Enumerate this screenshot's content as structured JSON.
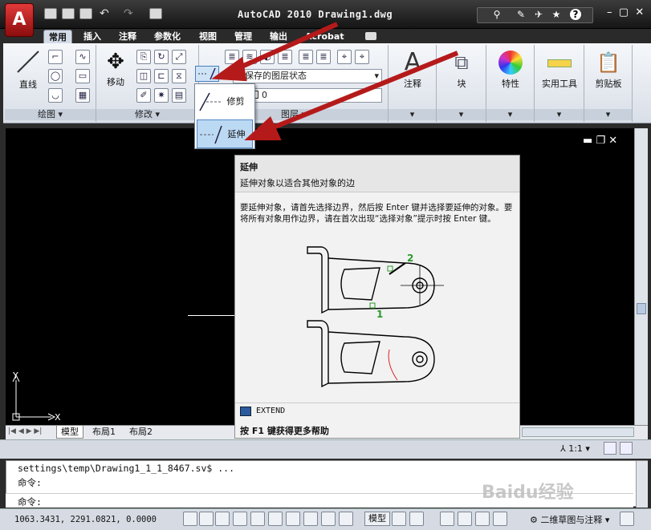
{
  "app": {
    "title": "AutoCAD 2010  Drawing1.dwg",
    "logo_letter": "A",
    "accent_color": "#c41e1e"
  },
  "quick_access": {
    "icons": [
      "new-icon",
      "open-icon",
      "save-icon",
      "undo-icon",
      "redo-icon",
      "plot-icon"
    ]
  },
  "ribbon": {
    "tabs": [
      "常用",
      "插入",
      "注释",
      "参数化",
      "视图",
      "管理",
      "输出",
      "Acrobat"
    ],
    "active_tab": "常用",
    "panels": {
      "draw": {
        "label": "绘图 ▾",
        "line_label": "直线"
      },
      "modify": {
        "label": "修改 ▾",
        "move_label": "移动"
      },
      "layers": {
        "label": "图层 ▾",
        "layer_state": "未保存的图层状态",
        "current_layer": "0"
      },
      "annotation": {
        "label": "注释"
      },
      "block": {
        "label": "块"
      },
      "properties": {
        "label": "特性"
      },
      "utilities": {
        "label": "实用工具"
      },
      "clipboard": {
        "label": "剪贴板"
      }
    }
  },
  "dropdown": {
    "items": [
      {
        "label": "修剪",
        "selected": false
      },
      {
        "label": "延伸",
        "selected": true
      }
    ]
  },
  "tooltip": {
    "title": "延伸",
    "subtitle": "延伸对象以适合其他对象的边",
    "body": "要延伸对象，请首先选择边界，然后按 Enter 键并选择要延伸的对象。要将所有对象用作边界，请在首次出现“选择对象”提示时按 Enter 键。",
    "marker_1": "1",
    "marker_2": "2",
    "command": "EXTEND",
    "help_hint": "按 F1 键获得更多帮助"
  },
  "canvas": {
    "ucs_x": "X",
    "ucs_y": "Y"
  },
  "layout_tabs": [
    "模型",
    "布局1",
    "布局2"
  ],
  "annotation_scale": "1:1",
  "command_line": {
    "history_1": "settings\\temp\\Drawing1_1_1_8467.sv$ ...",
    "history_2": "命令:",
    "prompt": "命令:"
  },
  "status": {
    "coordinates": "1063.3431, 2291.0821, 0.0000",
    "model_label": "模型",
    "workspace": "二维草图与注释"
  },
  "watermark": "Baidu经验"
}
